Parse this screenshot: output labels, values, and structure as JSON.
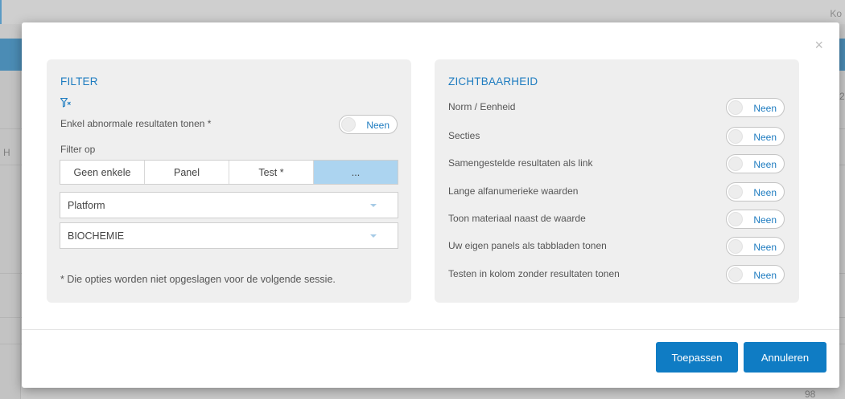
{
  "background": {
    "corner_text": "Ko",
    "edge_texts": [
      "H",
      "2",
      "98"
    ]
  },
  "modal": {
    "close_symbol": "×",
    "filter": {
      "title": "FILTER",
      "icon": "filter-clear-icon",
      "abnormal_label": "Enkel abnormale resultaten tonen *",
      "abnormal_toggle": "Neen",
      "filter_on_label": "Filter op",
      "segments": [
        "Geen enkele",
        "Panel",
        "Test *",
        "..."
      ],
      "active_segment": "...",
      "select_platform": "Platform",
      "select_section": "BIOCHEMIE",
      "footnote": "* Die opties worden niet opgeslagen voor de volgende sessie."
    },
    "visibility": {
      "title": "ZICHTBAARHEID",
      "rows": [
        {
          "label": "Norm / Eenheid",
          "toggle": "Neen"
        },
        {
          "label": "Secties",
          "toggle": "Neen"
        },
        {
          "label": "Samengestelde resultaten als link",
          "toggle": "Neen"
        },
        {
          "label": "Lange alfanumerieke waarden",
          "toggle": "Neen"
        },
        {
          "label": "Toon materiaal naast de waarde",
          "toggle": "Neen"
        },
        {
          "label": "Uw eigen panels als tabbladen tonen",
          "toggle": "Neen"
        },
        {
          "label": "Testen in kolom zonder resultaten tonen",
          "toggle": "Neen"
        }
      ]
    },
    "buttons": {
      "apply": "Toepassen",
      "cancel": "Annuleren"
    }
  },
  "colors": {
    "accent": "#1e7cc0",
    "button": "#0f7cc4",
    "active_segment": "#acd4f0",
    "panel_bg": "#efefef"
  }
}
